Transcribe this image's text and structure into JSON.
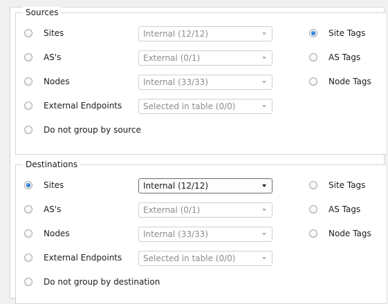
{
  "sources": {
    "title": "Sources",
    "rows": [
      {
        "label": "Sites",
        "checked": false,
        "select": "Internal (12/12)",
        "select_active": false,
        "tag_label": "Site Tags",
        "tag_checked": true
      },
      {
        "label": "AS's",
        "checked": false,
        "select": "External (0/1)",
        "select_active": false,
        "tag_label": "AS Tags",
        "tag_checked": false
      },
      {
        "label": "Nodes",
        "checked": false,
        "select": "Internal (33/33)",
        "select_active": false,
        "tag_label": "Node Tags",
        "tag_checked": false
      },
      {
        "label": "External Endpoints",
        "checked": false,
        "select": "Selected in table (0/0)",
        "select_active": false
      },
      {
        "label": "Do not group by source",
        "checked": false
      }
    ]
  },
  "destinations": {
    "title": "Destinations",
    "rows": [
      {
        "label": "Sites",
        "checked": true,
        "select": "Internal (12/12)",
        "select_active": true,
        "tag_label": "Site Tags",
        "tag_checked": false
      },
      {
        "label": "AS's",
        "checked": false,
        "select": "External (0/1)",
        "select_active": false,
        "tag_label": "AS Tags",
        "tag_checked": false
      },
      {
        "label": "Nodes",
        "checked": false,
        "select": "Internal (33/33)",
        "select_active": false,
        "tag_label": "Node Tags",
        "tag_checked": false
      },
      {
        "label": "External Endpoints",
        "checked": false,
        "select": "Selected in table (0/0)",
        "select_active": false
      },
      {
        "label": "Do not group by destination",
        "checked": false
      }
    ]
  }
}
